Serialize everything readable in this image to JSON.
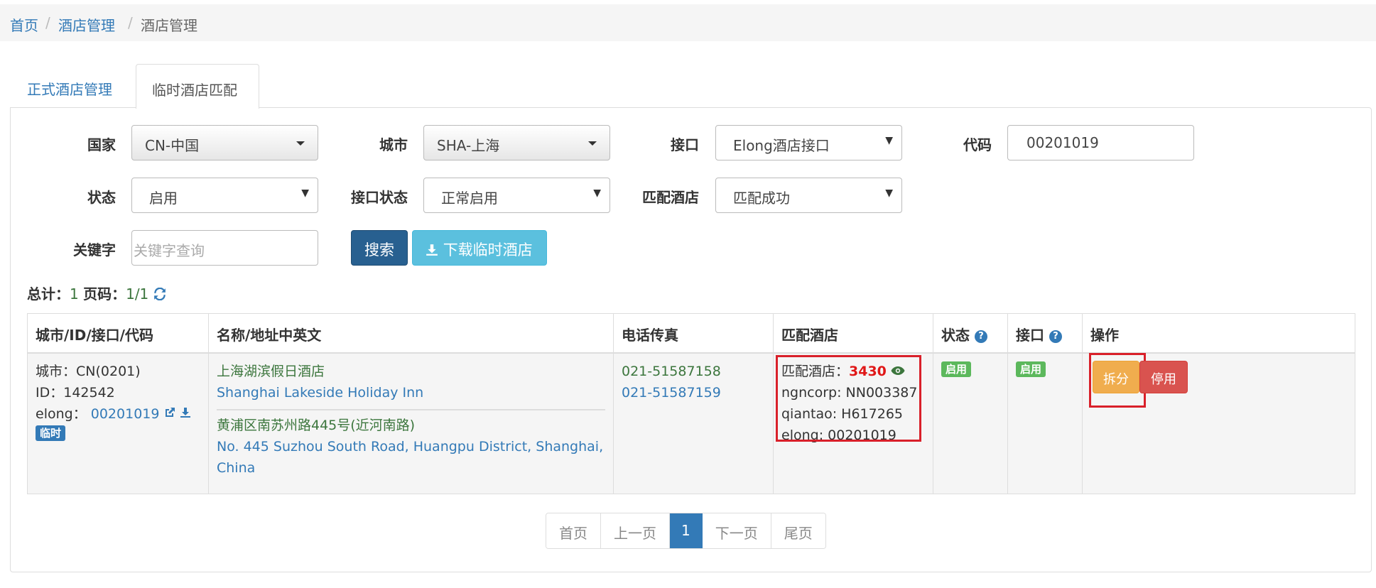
{
  "breadcrumb": {
    "home": "首页",
    "level2": "酒店管理",
    "current": "酒店管理",
    "sep": "/"
  },
  "tabs": [
    {
      "label": "正式酒店管理"
    },
    {
      "label": "临时酒店匹配"
    }
  ],
  "filters": {
    "country_label": "国家",
    "country_value": "CN-中国",
    "city_label": "城市",
    "city_value": "SHA-上海",
    "interface_label": "接口",
    "interface_value": "Elong酒店接口",
    "code_label": "代码",
    "code_value": "00201019",
    "status_label": "状态",
    "status_value": "启用",
    "interface_status_label": "接口状态",
    "interface_status_value": "正常启用",
    "match_label": "匹配酒店",
    "match_value": "匹配成功",
    "keyword_label": "关键字",
    "keyword_placeholder": "关键字查询",
    "search_button": "搜索",
    "download_button": "下载临时酒店"
  },
  "summary": {
    "total_label": "总计：",
    "total": "1",
    "page_label": "页码：",
    "page": "1/1"
  },
  "table": {
    "headers": [
      "城市/ID/接口/代码",
      "名称/地址中英文",
      "电话传真",
      "匹配酒店",
      "状态",
      "接口",
      "操作"
    ],
    "row": {
      "city": "城市：CN(0201)",
      "id": "ID：142542",
      "iface_prefix": "elong：",
      "iface_code": "00201019",
      "temp_badge": "临时",
      "name_cn": "上海湖滨假日酒店",
      "name_en": "Shanghai Lakeside Holiday Inn",
      "addr_cn": "黄浦区南苏州路445号(近河南路)",
      "addr_en_1": "No. 445 Suzhou South Road, Huangpu District, Shanghai,",
      "addr_en_2": "China",
      "phone": "021-51587158",
      "fax": "021-51587159",
      "match_prefix": "匹配酒店：",
      "match_id": "3430",
      "match_ngncorp": "ngncorp: NN003387",
      "match_qiantao": "qiantao: H617265",
      "match_elong": "elong: 00201019",
      "status_badge": "启用",
      "iface_badge": "启用",
      "split_button": "拆分",
      "disable_button": "停用"
    }
  },
  "pagination": {
    "first": "首页",
    "prev": "上一页",
    "current": "1",
    "next": "下一页",
    "last": "尾页"
  },
  "colors": {
    "primary": "#337ab7",
    "green": "#5cb85c",
    "warning": "#f0ad4e",
    "danger": "#d9534f",
    "info": "#5bc0de",
    "highlight": "#d9202a"
  }
}
